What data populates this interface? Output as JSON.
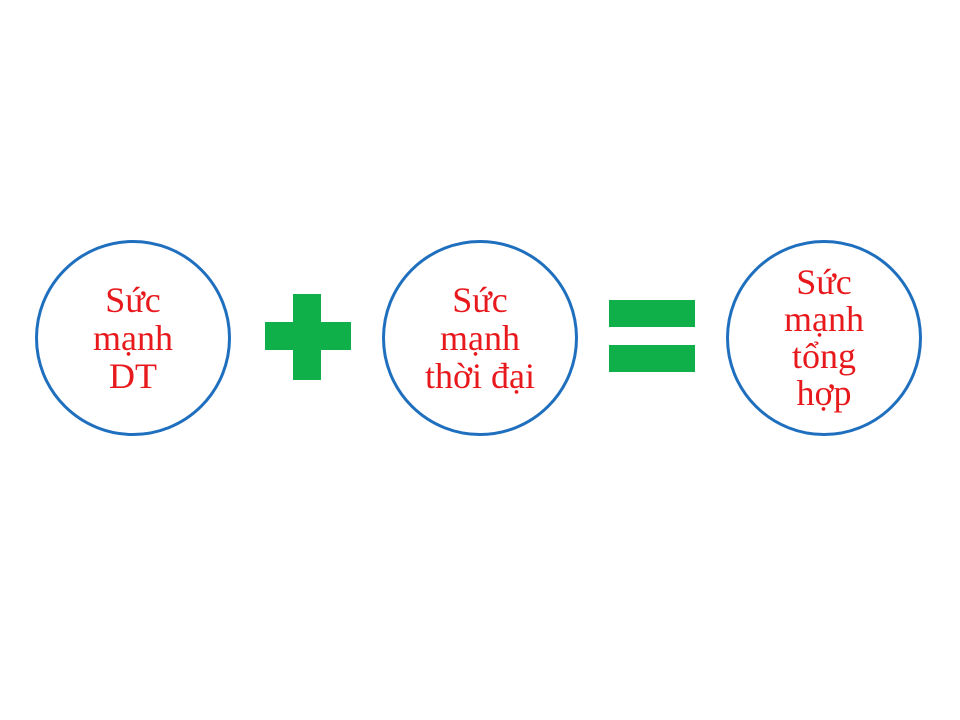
{
  "diagram": {
    "nodes": [
      {
        "id": "dt",
        "text": "Sức\nmạnh\nDT"
      },
      {
        "id": "thoi-dai",
        "text": "Sức\nmạnh\nthời đại"
      },
      {
        "id": "tong-hop",
        "text": "Sức\nmạnh\ntổng\nhợp"
      }
    ],
    "operators": [
      "plus",
      "equals"
    ],
    "colors": {
      "circle_border": "#1f6fbf",
      "node_text": "#e8191c",
      "operator": "#0faf4a",
      "background": "#ffffff"
    },
    "icons": {
      "plus": "plus-icon",
      "equals": "equals-icon"
    }
  }
}
